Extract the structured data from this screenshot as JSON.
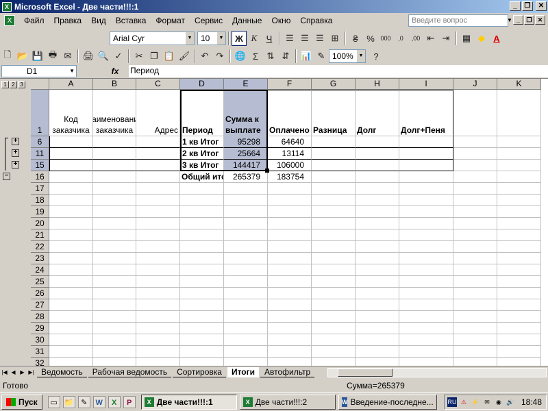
{
  "window": {
    "title": "Microsoft Excel - Две части!!!:1"
  },
  "menu": [
    {
      "label": "Файл"
    },
    {
      "label": "Правка"
    },
    {
      "label": "Вид"
    },
    {
      "label": "Вставка"
    },
    {
      "label": "Формат"
    },
    {
      "label": "Сервис"
    },
    {
      "label": "Данные"
    },
    {
      "label": "Окно"
    },
    {
      "label": "Справка"
    }
  ],
  "help": {
    "placeholder": "Введите вопрос"
  },
  "format_toolbar": {
    "font": "Arial Cyr",
    "size": "10",
    "bold": "Ж",
    "italic": "К",
    "underline": "Ч"
  },
  "standard_toolbar": {
    "zoom": "100%"
  },
  "formula_bar": {
    "name_box": "D1",
    "fx": "fx",
    "value": "Период"
  },
  "outline_levels": [
    "1",
    "2",
    "3"
  ],
  "columns": [
    "A",
    "B",
    "C",
    "D",
    "E",
    "F",
    "G",
    "H",
    "I",
    "J",
    "K"
  ],
  "rows": [
    "1",
    "6",
    "11",
    "15",
    "16",
    "17",
    "18",
    "19",
    "20",
    "21",
    "22",
    "23",
    "24",
    "25",
    "26",
    "27",
    "28",
    "29",
    "30",
    "31",
    "32"
  ],
  "headers": {
    "a": "Код заказчика",
    "b": "Наименование заказчика",
    "c": "Адрес",
    "d": "Период",
    "e": "Сумма к выплате",
    "f": "Оплачено",
    "g": "Разница",
    "h": "Долг",
    "i": "Долг+Пеня"
  },
  "data_rows": [
    {
      "period": "1 кв Итог",
      "sum": "95298",
      "paid": "64640"
    },
    {
      "period": "2 кв Итог",
      "sum": "25664",
      "paid": "13114"
    },
    {
      "period": "3 кв Итог",
      "sum": "144417",
      "paid": "106000"
    },
    {
      "period": "Общий ито",
      "sum": "265379",
      "paid": "183754"
    }
  ],
  "sheet_tabs": [
    {
      "label": "Ведомость",
      "active": false
    },
    {
      "label": "Рабочая ведомость",
      "active": false
    },
    {
      "label": "Сортировка",
      "active": false
    },
    {
      "label": "Итоги",
      "active": true
    },
    {
      "label": "Автофильтр",
      "active": false
    }
  ],
  "status": {
    "ready": "Готово",
    "sum": "Сумма=265379"
  },
  "taskbar": {
    "start": "Пуск",
    "tasks": [
      {
        "label": "Две части!!!:1",
        "active": true,
        "app": "excel"
      },
      {
        "label": "Две части!!!:2",
        "active": false,
        "app": "excel"
      },
      {
        "label": "Введение-последне...",
        "active": false,
        "app": "word"
      }
    ],
    "lang": "RU",
    "clock": "18:48"
  }
}
